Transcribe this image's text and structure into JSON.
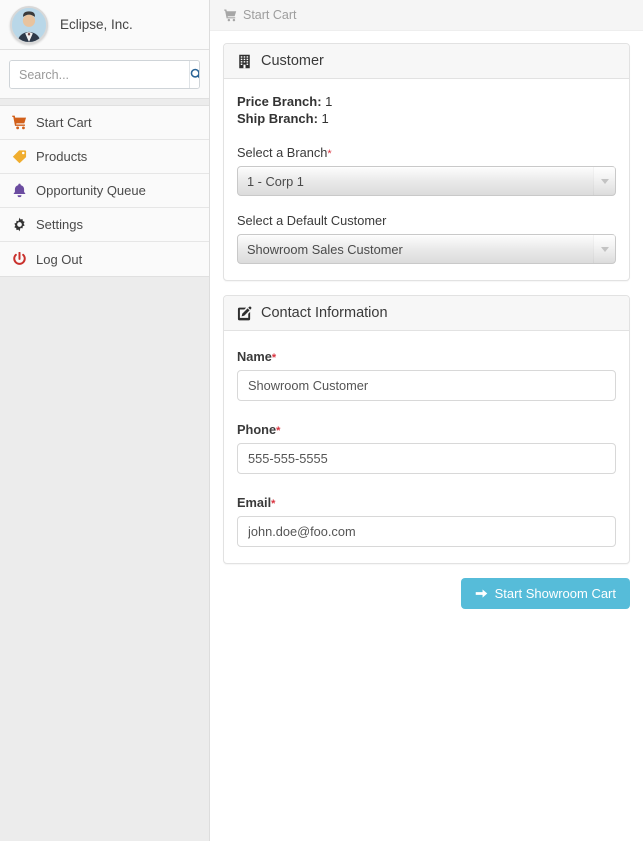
{
  "sidebar": {
    "brand": {
      "name": "Eclipse, Inc.",
      "avatar_icon": "user-avatar"
    },
    "search": {
      "placeholder": "Search...",
      "value": "",
      "button_icon": "search-icon"
    },
    "items": [
      {
        "label": "Start Cart",
        "icon": "shopping-cart-icon",
        "color": "#d2601a"
      },
      {
        "label": "Products",
        "icon": "tag-icon",
        "color": "#f0ad2e"
      },
      {
        "label": "Opportunity Queue",
        "icon": "bell-icon",
        "color": "#6b4ca0"
      },
      {
        "label": "Settings",
        "icon": "gear-icon",
        "color": "#333333"
      },
      {
        "label": "Log Out",
        "icon": "power-off-icon",
        "color": "#c9302c"
      }
    ]
  },
  "breadcrumb": {
    "icon": "shopping-cart-icon",
    "label": "Start Cart"
  },
  "customer_panel": {
    "icon": "building-icon",
    "title": "Customer",
    "price_branch_label": "Price Branch:",
    "price_branch_value": "1",
    "ship_branch_label": "Ship Branch:",
    "ship_branch_value": "1",
    "branch_label": "Select a Branch",
    "branch_required": "*",
    "branch_value": "1 - Corp 1",
    "default_customer_label": "Select a Default Customer",
    "default_customer_value": "Showroom Sales Customer"
  },
  "contact_panel": {
    "icon": "pencil-square-icon",
    "title": "Contact Information",
    "name_label": "Name",
    "name_required": "*",
    "name_value": "Showroom Customer",
    "phone_label": "Phone",
    "phone_required": "*",
    "phone_value": "555-555-5555",
    "email_label": "Email",
    "email_required": "*",
    "email_value": "john.doe@foo.com"
  },
  "actions": {
    "submit_label": "Start Showroom Cart",
    "submit_icon": "arrow-right-icon",
    "submit_color": "#56bcd9"
  }
}
